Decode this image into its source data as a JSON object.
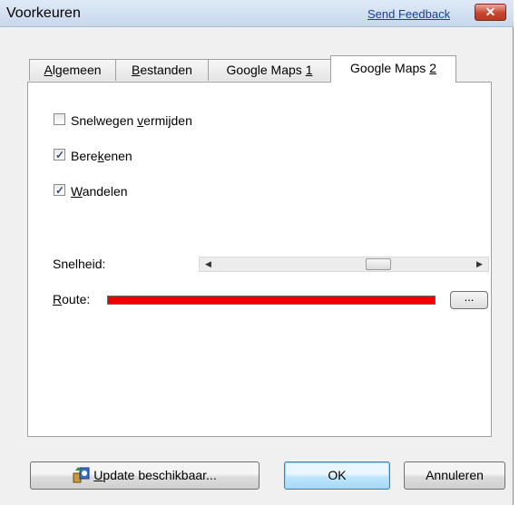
{
  "window": {
    "title": "Voorkeuren",
    "feedback_link": "Send Feedback",
    "close_symbol": "✕"
  },
  "tabs": [
    {
      "label": "Algemeen",
      "accel": "A",
      "rest": "lgemeen",
      "active": false
    },
    {
      "label": "Bestanden",
      "accel": "B",
      "rest": "estanden",
      "active": false
    },
    {
      "label": "Google Maps 1",
      "pre": "Google Maps ",
      "accel": "1",
      "active": false
    },
    {
      "label": "Google Maps 2",
      "pre": "Google Maps ",
      "accel": "2",
      "active": true
    }
  ],
  "checkboxes": [
    {
      "label": "Snelwegen vermijden",
      "pre": "Snelwegen ",
      "accel": "v",
      "post": "ermijden",
      "checked": false
    },
    {
      "label": "Berekenen",
      "pre": "Bere",
      "accel": "k",
      "post": "enen",
      "checked": true
    },
    {
      "label": "Wandelen",
      "pre": "",
      "accel": "W",
      "post": "andelen",
      "checked": true
    }
  ],
  "check_mark": "✓",
  "speed": {
    "label": "Snelheid:",
    "left_arrow": "◀",
    "right_arrow": "▶",
    "value_fraction": 0.65
  },
  "route": {
    "label_accel": "R",
    "label_post": "oute:",
    "color": "#ee0000",
    "browse_label": "..."
  },
  "buttons": {
    "update_accel": "U",
    "update_post": "pdate beschikbaar...",
    "ok": "OK",
    "cancel": "Annuleren"
  },
  "icons": {
    "update": "update-icon",
    "close": "close-icon"
  }
}
